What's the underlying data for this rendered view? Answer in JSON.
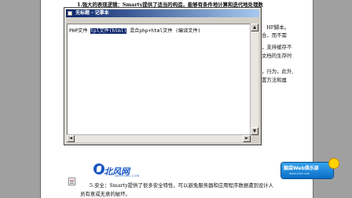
{
  "document": {
    "lines": [
      {
        "text": "1.强大的表现逻辑：Smarty提供了适当的构造，能够有条件地计算和迭代地处理数"
      },
      {
        "text": "合，而不需"
      },
      {
        "text": "HP脚本。"
      },
      {
        "text": "序。"
      },
      {
        "text": "，支持缓存不"
      },
      {
        "text": "文档的生存时"
      },
      {
        "text": "，行为，此外,"
      },
      {
        "text": "置方法和属"
      },
      {
        "text": "5.安全：Smarty提供了很多安全特性，可以避免服务器和应用程序数据遭到设计人"
      },
      {
        "text": "员有意或无意的破坏。"
      }
    ]
  },
  "notepad": {
    "title": "无标题 - 记事本",
    "editor": {
      "part1": "PHP文件 ",
      "part2": "tpl文件(html)",
      "part3": " 混合php+html文件 (编译文件)"
    },
    "scroll_up": "▲",
    "scroll_down": "▼",
    "scroll_left": "◄",
    "scroll_right": "►"
  },
  "watermark": {
    "logo_text": "北风网",
    "logo_sub": "IBEIFENG.COM",
    "badge_title": "脑袋Web俱乐部",
    "badge_sub": "www.ycku.com"
  }
}
